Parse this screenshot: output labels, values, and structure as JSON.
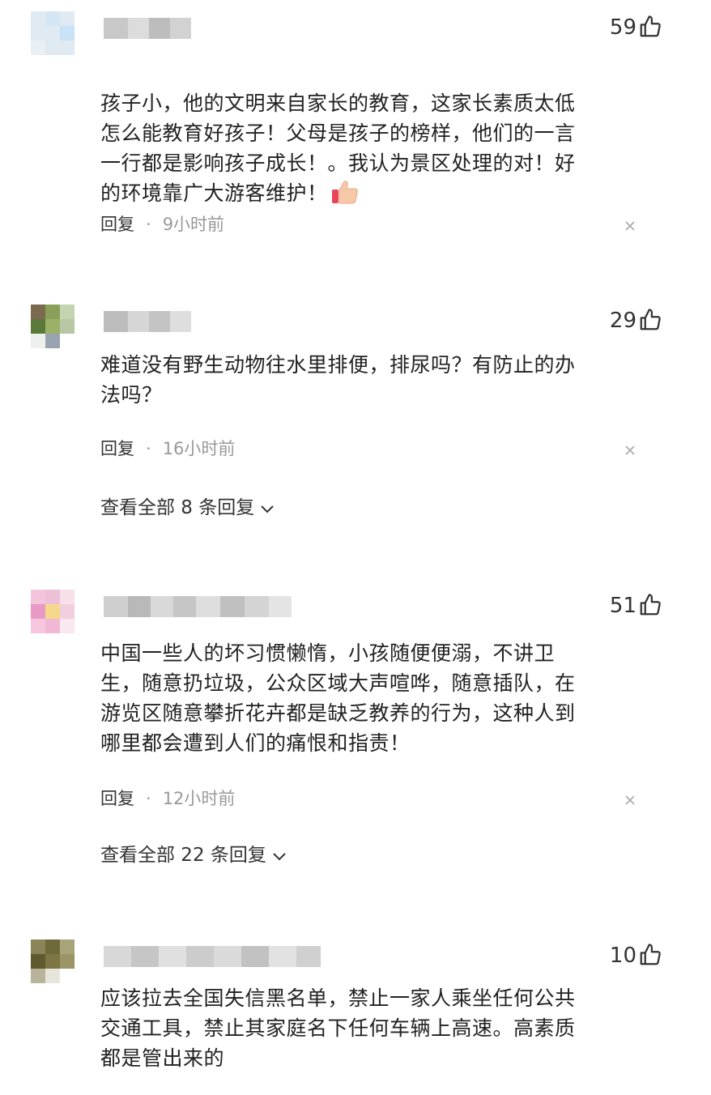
{
  "comments": [
    {
      "likes": "59",
      "text": "孩子小，他的文明来自家长的教育，这家长素质太低\n怎么能教育好孩子！父母是孩子的榜样，他们的一言\n一行都是影响孩子成长！。我认为景区处理的对！好\n的环境靠广大游客维护！",
      "reply_label": "回复",
      "separator": "·",
      "time": "9小时前",
      "emoji_icon": "thumbs-up-emoji"
    },
    {
      "likes": "29",
      "text": "难道没有野生动物往水里排便，排尿吗？有防止的办\n法吗？",
      "reply_label": "回复",
      "separator": "·",
      "time": "16小时前",
      "view_replies": "查看全部 8 条回复"
    },
    {
      "likes": "51",
      "text": "中国一些人的坏习惯懒惰，小孩随便便溺，不讲卫\n生，随意扔垃圾，公众区域大声喧哗，随意插队，在\n游览区随意攀折花卉都是缺乏教养的行为，这种人到\n哪里都会遭到人们的痛恨和指责！",
      "reply_label": "回复",
      "separator": "·",
      "time": "12小时前",
      "view_replies": "查看全部 22 条回复"
    },
    {
      "likes": "10",
      "text": "应该拉去全国失信黑名单，禁止一家人乘坐任何公共\n交通工具，禁止其家庭名下任何车辆上高速。高素质\n都是管出来的"
    }
  ],
  "icons": {
    "like": "thumbs-up-icon",
    "close": "close-icon",
    "chevron": "chevron-down-icon"
  },
  "colors": {
    "text": "#222222",
    "meta": "#999999",
    "background": "#ffffff"
  }
}
